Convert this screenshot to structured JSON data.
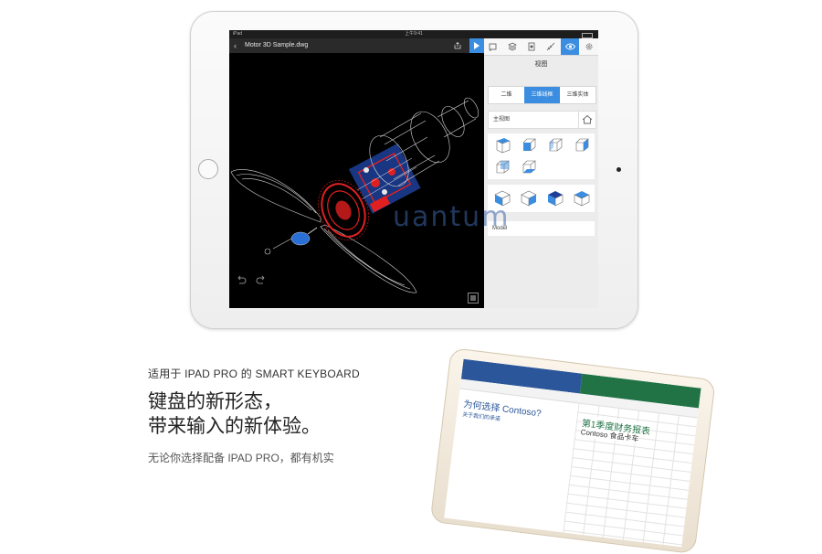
{
  "ipad": {
    "status": {
      "carrier": "iPad",
      "time": "上午9:41"
    },
    "file_title": "Motor 3D Sample.dwg",
    "panel": {
      "title": "视图",
      "segments": [
        "二维",
        "三维线框",
        "三维实体"
      ],
      "active_segment": "三维线框",
      "views_label": "主视图",
      "model_label": "Model"
    },
    "watermark": "uantum"
  },
  "promo": {
    "keyboard_label": "适用于 IPAD PRO 的 SMART KEYBOARD",
    "headline_line1": "键盘的新形态，",
    "headline_line2": "带来输入的新体验。",
    "body_partial": "无论你选择配备 IPAD PRO，都有机实"
  },
  "ipad2": {
    "word_title": "为何选择 Contoso?",
    "word_sub": "关于我们的承诺",
    "excel_title": "第1季度财务报表",
    "excel_sub": "Contoso 食品卡车"
  },
  "colors": {
    "accent": "#3a8de0",
    "word": "#2b579a",
    "excel": "#217346"
  }
}
